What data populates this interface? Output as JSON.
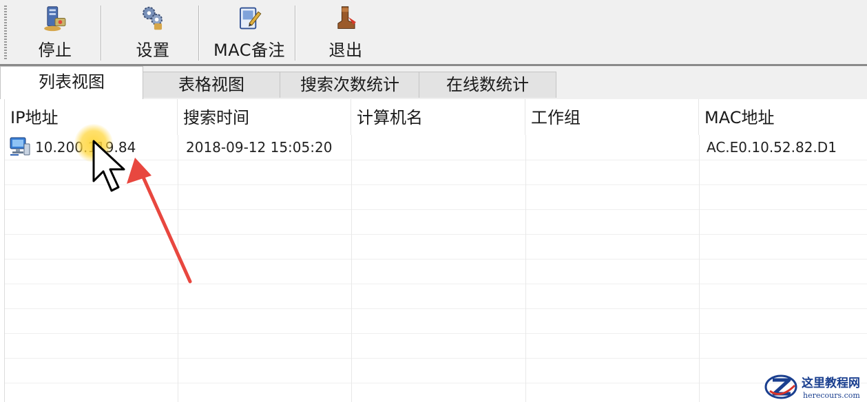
{
  "toolbar": {
    "buttons": [
      {
        "label": "停止",
        "icon": "stop-server-icon"
      },
      {
        "label": "设置",
        "icon": "gears-icon"
      },
      {
        "label": "MAC备注",
        "icon": "note-edit-icon"
      },
      {
        "label": "退出",
        "icon": "exit-boot-icon"
      }
    ]
  },
  "tabs": [
    {
      "label": "列表视图",
      "active": true
    },
    {
      "label": "表格视图",
      "active": false
    },
    {
      "label": "搜索次数统计",
      "active": false
    },
    {
      "label": "在线数统计",
      "active": false
    }
  ],
  "table": {
    "columns": [
      "IP地址",
      "搜索时间",
      "计算机名",
      "工作组",
      "MAC地址"
    ],
    "rows": [
      {
        "ip": "10.200.119.84",
        "time": "2018-09-12 15:05:20",
        "computer": "",
        "workgroup": "",
        "mac": "AC.E0.10.52.82.D1",
        "icon": "computer-network-icon"
      }
    ]
  },
  "watermark": {
    "cn": "这里教程网",
    "en": "herecours.com",
    "accent": "#1a3f8f"
  },
  "colors": {
    "annotation_arrow": "#e8473f",
    "cursor_highlight": "#ffd63c"
  }
}
